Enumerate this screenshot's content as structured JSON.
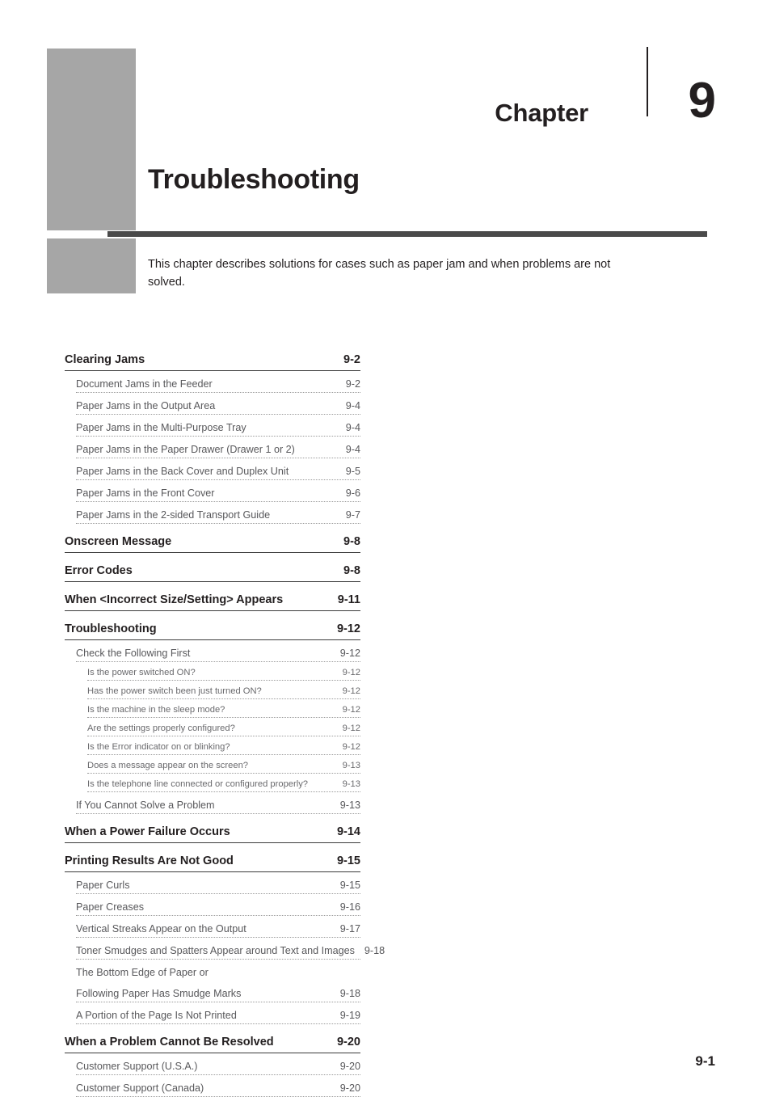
{
  "chapter": {
    "word": "Chapter",
    "number": "9",
    "title": "Troubleshooting",
    "intro": "This chapter describes solutions for cases such as paper jam and when problems are not solved."
  },
  "colors": {
    "gray_block": "#a6a6a6",
    "dark_rule": "#4a4a4a",
    "text": "#231f20",
    "leader": "#9b9b9b"
  },
  "toc": [
    {
      "level": 1,
      "label": "Clearing Jams",
      "page": "9-2"
    },
    {
      "level": 2,
      "label": "Document Jams in the Feeder",
      "page": "9-2"
    },
    {
      "level": 2,
      "label": "Paper Jams in the Output Area",
      "page": "9-4"
    },
    {
      "level": 2,
      "label": "Paper Jams in the Multi-Purpose Tray",
      "page": "9-4"
    },
    {
      "level": 2,
      "label": "Paper Jams in the Paper Drawer (Drawer 1 or 2)",
      "page": "9-4"
    },
    {
      "level": 2,
      "label": "Paper Jams in the Back Cover and Duplex Unit",
      "page": "9-5"
    },
    {
      "level": 2,
      "label": "Paper Jams in the Front Cover",
      "page": "9-6"
    },
    {
      "level": 2,
      "label": "Paper Jams in the 2-sided Transport Guide",
      "page": "9-7"
    },
    {
      "level": 1,
      "label": "Onscreen Message",
      "page": "9-8"
    },
    {
      "level": 1,
      "label": "Error Codes",
      "page": "9-8"
    },
    {
      "level": 1,
      "label": "When <Incorrect Size/Setting> Appears",
      "page": "9-11"
    },
    {
      "level": 1,
      "label": "Troubleshooting",
      "page": "9-12"
    },
    {
      "level": 2,
      "label": "Check the Following First",
      "page": "9-12"
    },
    {
      "level": 3,
      "label": "Is the power switched ON?",
      "page": "9-12"
    },
    {
      "level": 3,
      "label": "Has the power switch been just turned ON?",
      "page": "9-12"
    },
    {
      "level": 3,
      "label": "Is the machine in the sleep mode?",
      "page": "9-12"
    },
    {
      "level": 3,
      "label": "Are the settings properly configured?",
      "page": "9-12"
    },
    {
      "level": 3,
      "label": "Is the Error indicator on or blinking?",
      "page": "9-12"
    },
    {
      "level": 3,
      "label": "Does a message appear on the screen?",
      "page": "9-13"
    },
    {
      "level": 3,
      "label": "Is the telephone line connected or configured properly?",
      "page": "9-13"
    },
    {
      "level": 2,
      "label": "If You Cannot Solve a Problem",
      "page": "9-13"
    },
    {
      "level": 1,
      "label": "When a Power Failure Occurs",
      "page": "9-14"
    },
    {
      "level": 1,
      "label": "Printing Results Are Not Good",
      "page": "9-15"
    },
    {
      "level": 2,
      "label": "Paper Curls",
      "page": "9-15"
    },
    {
      "level": 2,
      "label": "Paper Creases",
      "page": "9-16"
    },
    {
      "level": 2,
      "label": "Vertical Streaks Appear on the Output",
      "page": "9-17"
    },
    {
      "level": 2,
      "label": "Toner Smudges and Spatters Appear around Text and Images",
      "page": "9-18"
    },
    {
      "level": 2,
      "label": "The Bottom Edge of Paper or",
      "page": "",
      "wrapped": true
    },
    {
      "level": 2,
      "label": "Following Paper Has Smudge Marks",
      "page": "9-18"
    },
    {
      "level": 2,
      "label": "A Portion of the Page Is Not Printed",
      "page": "9-19"
    },
    {
      "level": 1,
      "label": "When a Problem Cannot Be Resolved",
      "page": "9-20"
    },
    {
      "level": 2,
      "label": "Customer Support (U.S.A.)",
      "page": "9-20"
    },
    {
      "level": 2,
      "label": "Customer Support (Canada)",
      "page": "9-20"
    }
  ],
  "footer": {
    "page_number": "9-1"
  }
}
